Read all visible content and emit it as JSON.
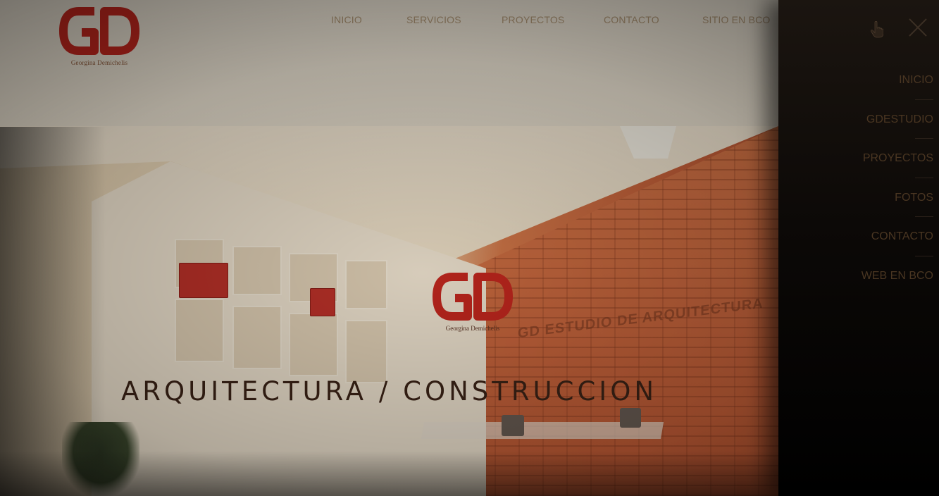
{
  "brand": {
    "logo_letters": "GD",
    "name": "Georgina Demichelis",
    "accent_color": "#c8281f"
  },
  "top_nav": {
    "items": [
      "INICIO",
      "SERVICIOS",
      "PROYECTOS",
      "CONTACTO",
      "SITIO EN BCO"
    ]
  },
  "hero": {
    "tagline": "ARQUITECTURA / CONSTRUCCION",
    "wall_sign": "GD ESTUDIO DE ARQUITECTURA"
  },
  "side_menu": {
    "items": [
      "INICIO",
      "GDESTUDIO",
      "PROYECTOS",
      "FOTOS",
      "CONTACTO",
      "WEB EN BCO"
    ],
    "close_icon": "close-icon",
    "cursor_icon": "hand-pointer-icon"
  }
}
